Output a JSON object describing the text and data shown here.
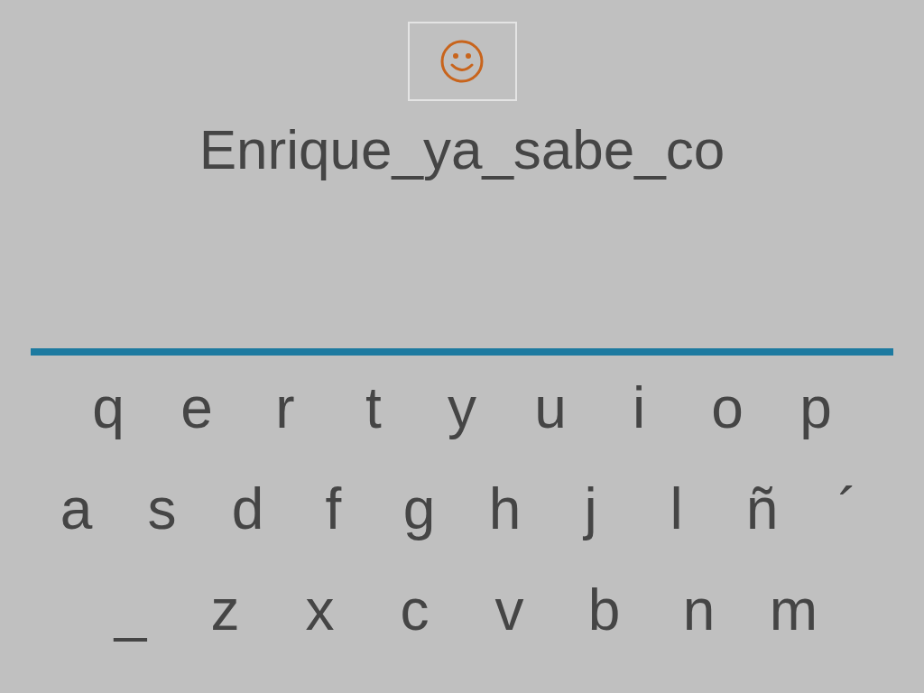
{
  "phrase": "Enrique_ya_sabe_co",
  "keyboard": {
    "rows": [
      {
        "keys": [
          "q",
          "e",
          "r",
          "t",
          "y",
          "u",
          "i",
          "o",
          "p"
        ]
      },
      {
        "keys": [
          "a",
          "s",
          "d",
          "f",
          "g",
          "h",
          "j",
          "l",
          "ñ",
          "´"
        ]
      },
      {
        "keys": [
          "_",
          "z",
          "x",
          "c",
          "v",
          "b",
          "n",
          "m"
        ]
      }
    ]
  }
}
